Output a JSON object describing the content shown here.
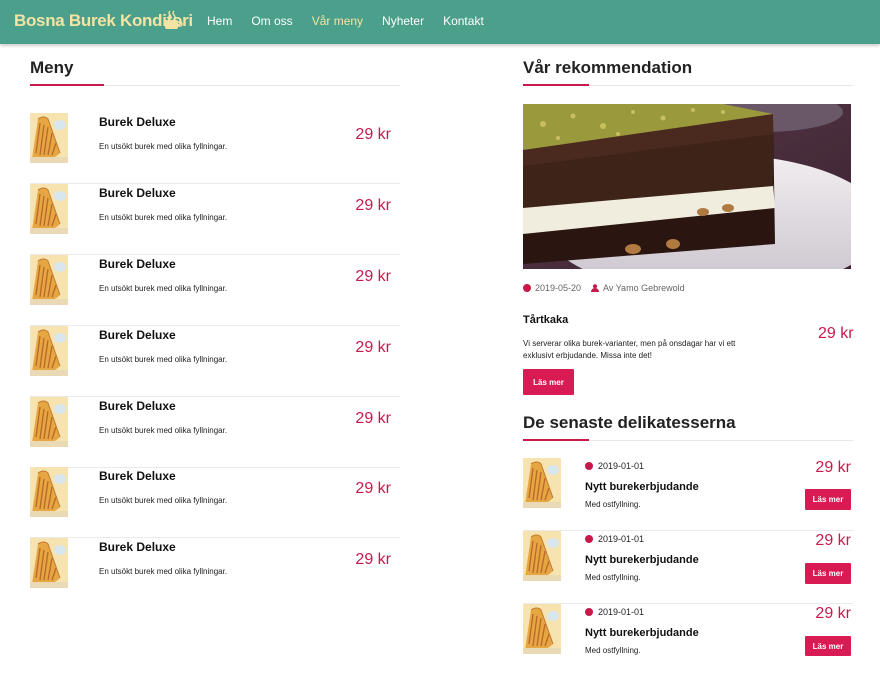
{
  "nav": {
    "brand": "Bosna Burek Konditori",
    "links": [
      {
        "label": "Hem",
        "active": false
      },
      {
        "label": "Om oss",
        "active": false
      },
      {
        "label": "Vår meny",
        "active": true
      },
      {
        "label": "Nyheter",
        "active": false
      },
      {
        "label": "Kontakt",
        "active": false
      }
    ]
  },
  "colors": {
    "nav_bg": "#4aa08b",
    "brand": "#f3e4a3",
    "accent": "#c8194b",
    "button": "#d81b53"
  },
  "menu": {
    "heading": "Meny",
    "items": [
      {
        "name": "Burek Deluxe",
        "desc": "En utsökt burek med olika fyllningar.",
        "price": "29 kr"
      },
      {
        "name": "Burek Deluxe",
        "desc": "En utsökt burek med olika fyllningar.",
        "price": "29 kr"
      },
      {
        "name": "Burek Deluxe",
        "desc": "En utsökt burek med olika fyllningar.",
        "price": "29 kr"
      },
      {
        "name": "Burek Deluxe",
        "desc": "En utsökt burek med olika fyllningar.",
        "price": "29 kr"
      },
      {
        "name": "Burek Deluxe",
        "desc": "En utsökt burek med olika fyllningar.",
        "price": "29 kr"
      },
      {
        "name": "Burek Deluxe",
        "desc": "En utsökt burek med olika fyllningar.",
        "price": "29 kr"
      },
      {
        "name": "Burek Deluxe",
        "desc": "En utsökt burek med olika fyllningar.",
        "price": "29 kr"
      }
    ]
  },
  "recommendation": {
    "heading": "Vår rekommendation",
    "date": "2019-05-20",
    "author": "Av Yamo Gebrewold",
    "title": "Tårtkaka",
    "desc": "Vi serverar olika burek-varianter, men på onsdagar har vi ett exklusivt erbjudande. Missa inte det!",
    "price": "29 kr",
    "button": "Läs mer"
  },
  "latest": {
    "heading": "De senaste delikatesserna",
    "items": [
      {
        "date": "2019-01-01",
        "title": "Nytt burekerbjudande",
        "desc": "Med ostfyllning.",
        "price": "29 kr",
        "button": "Läs mer"
      },
      {
        "date": "2019-01-01",
        "title": "Nytt burekerbjudande",
        "desc": "Med ostfyllning.",
        "price": "29 kr",
        "button": "Läs mer"
      },
      {
        "date": "2019-01-01",
        "title": "Nytt burekerbjudande",
        "desc": "Med ostfyllning.",
        "price": "29 kr",
        "button": "Läs mer"
      }
    ]
  }
}
